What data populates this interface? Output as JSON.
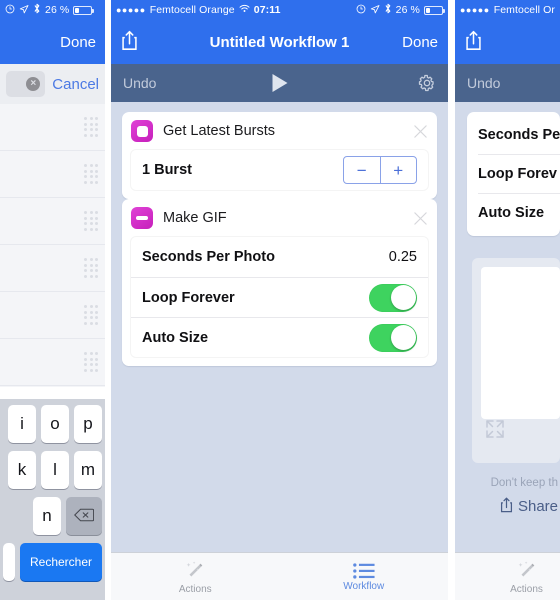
{
  "left_panel": {
    "status_bar": {
      "alarm_icon": "alarm-icon",
      "location_icon": "location-arrow-icon",
      "bluetooth_icon": "bluetooth-icon",
      "battery_percent": "26 %",
      "battery_icon": "battery-icon"
    },
    "nav": {
      "done_label": "Done"
    },
    "search": {
      "value": "",
      "placeholder": "",
      "clear_icon": "clear-circle-icon",
      "cancel_label": "Cancel"
    },
    "list_rows": [
      {
        "handle": "drag-handle"
      },
      {
        "handle": "drag-handle"
      },
      {
        "handle": "drag-handle"
      },
      {
        "handle": "drag-handle"
      },
      {
        "handle": "drag-handle"
      },
      {
        "handle": "drag-handle"
      }
    ],
    "keyboard": {
      "row1": [
        "i",
        "o",
        "p"
      ],
      "row2": [
        "k",
        "l",
        "m"
      ],
      "row3": [
        "n"
      ],
      "backspace_icon": "backspace-icon",
      "search_key_label": "Rechercher"
    }
  },
  "center_panel": {
    "status_bar": {
      "signal_dots": "●●●●●",
      "carrier": "Femtocell Orange",
      "wifi_icon": "wifi-icon",
      "time": "07:11",
      "alarm_icon": "alarm-icon",
      "location_icon": "location-arrow-icon",
      "bluetooth_icon": "bluetooth-icon",
      "battery_percent": "26 %",
      "battery_icon": "battery-icon"
    },
    "nav": {
      "share_icon": "share-icon",
      "title": "Untitled Workflow 1",
      "done_label": "Done"
    },
    "toolbar": {
      "undo_label": "Undo",
      "play_icon": "play-icon",
      "settings_icon": "gear-icon"
    },
    "actions": [
      {
        "icon": "get-latest-bursts-icon",
        "title": "Get Latest Bursts",
        "close_icon": "close-icon",
        "rows": [
          {
            "type": "stepper",
            "label": "1 Burst",
            "minus_label": "−",
            "plus_label": "+"
          }
        ]
      },
      {
        "icon": "make-gif-icon",
        "title": "Make GIF",
        "close_icon": "close-icon",
        "rows": [
          {
            "type": "value",
            "label": "Seconds Per Photo",
            "value": "0.25"
          },
          {
            "type": "switch",
            "label": "Loop Forever",
            "value": "on"
          },
          {
            "type": "switch",
            "label": "Auto Size",
            "value": "on"
          }
        ]
      }
    ],
    "tabs": [
      {
        "label": "Actions",
        "icon": "magic-wand-icon",
        "active": false
      },
      {
        "label": "Workflow",
        "icon": "list-icon",
        "active": true
      }
    ]
  },
  "right_panel": {
    "status_bar": {
      "signal_dots": "●●●●●",
      "carrier": "Femtocell Or"
    },
    "nav": {
      "share_icon": "share-icon"
    },
    "toolbar": {
      "undo_label": "Undo"
    },
    "rows": [
      {
        "label": "Seconds Pe"
      },
      {
        "label": "Loop Forev"
      },
      {
        "label": "Auto Size"
      }
    ],
    "preview": {
      "expand_icon": "expand-icon"
    },
    "note": "Don't keep th",
    "share": {
      "icon": "share-icon",
      "label": "Share"
    },
    "tabs": [
      {
        "label": "Actions",
        "icon": "magic-wand-icon",
        "active": false
      }
    ]
  },
  "colors": {
    "nav_blue": "#2f6fed",
    "toolbar_slate": "#4a648d",
    "canvas": "#d2daea",
    "action_magenta": "#d62bc8",
    "switch_green": "#3ed35f",
    "tint_blue": "#4b79e4",
    "key_blue": "#1a78f2"
  }
}
